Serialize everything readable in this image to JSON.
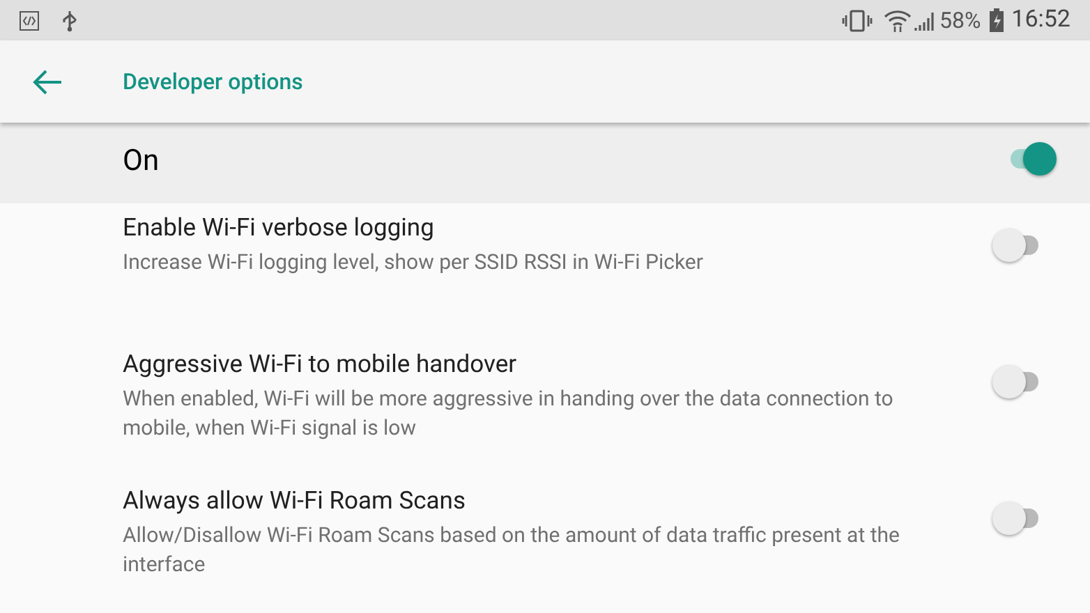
{
  "status_bar": {
    "battery": "58%",
    "time": "16:52"
  },
  "app_bar": {
    "title": "Developer options"
  },
  "master_switch": {
    "label": "On",
    "on": true
  },
  "settings": [
    {
      "title": "Enable Wi-Fi verbose logging",
      "summary": "Increase Wi-Fi logging level, show per SSID RSSI in Wi-Fi Picker",
      "on": false
    },
    {
      "title": "Aggressive Wi-Fi to mobile handover",
      "summary": "When enabled, Wi-Fi will be more aggressive in handing over the data connection to mobile, when Wi-Fi signal is low",
      "on": false
    },
    {
      "title": "Always allow Wi-Fi Roam Scans",
      "summary": "Allow/Disallow Wi-Fi Roam Scans based on the amount of data traffic present at the interface",
      "on": false
    }
  ]
}
